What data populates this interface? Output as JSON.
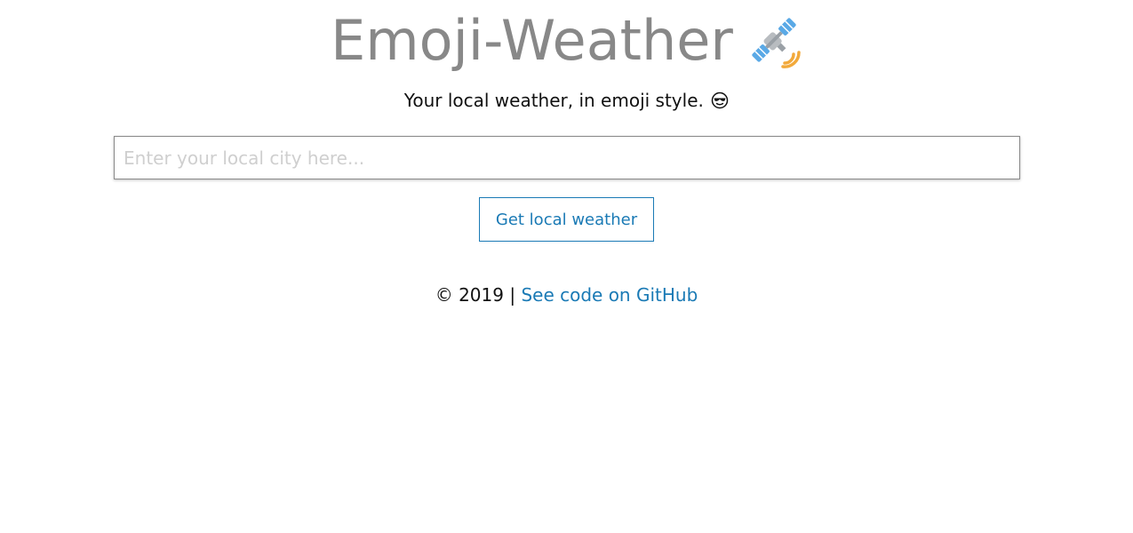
{
  "header": {
    "title": "Emoji-Weather",
    "title_icon": "satellite-icon"
  },
  "tagline": {
    "text": "Your local weather, in emoji style.",
    "icon": "sunglasses-face-icon"
  },
  "search": {
    "placeholder": "Enter your local city here...",
    "value": ""
  },
  "actions": {
    "get_weather_label": "Get local weather"
  },
  "footer": {
    "copyright": "© 2019 |",
    "github_link_label": "See code on GitHub"
  },
  "colors": {
    "title_gray": "#888888",
    "link_blue": "#1a7ab5",
    "placeholder_gray": "#cfcfcf"
  }
}
